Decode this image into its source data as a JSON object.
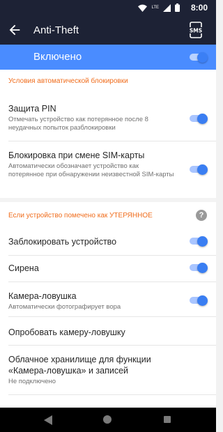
{
  "status_bar": {
    "time": "8:00",
    "network": "LTE"
  },
  "app_bar": {
    "title": "Anti-Theft"
  },
  "master": {
    "label": "Включено",
    "on": true
  },
  "auto_lock": {
    "header": "Условия автоматической блокировки",
    "items": [
      {
        "title": "Защита PIN",
        "subtitle": "Отмечать устройство как потерянное после 8 неудачных попыток разблокировки",
        "on": true
      },
      {
        "title": "Блокировка при смене SIM-карты",
        "subtitle": "Автоматически обозначает устройство как потерянное при обнаружении неизвестной SIM-карты",
        "on": true
      }
    ]
  },
  "lost": {
    "header": "Если устройство помечено как УТЕРЯННОЕ",
    "help": "?",
    "items": [
      {
        "title": "Заблокировать устройство",
        "on": true
      },
      {
        "title": "Сирена",
        "on": true
      },
      {
        "title": "Камера-ловушка",
        "subtitle": "Автоматически фотографирует вора",
        "on": true
      },
      {
        "title": "Опробовать камеру-ловушку"
      },
      {
        "title": "Облачное хранилище для функции «Камера-ловушка» и записей",
        "subtitle": "Не подключено"
      }
    ]
  }
}
